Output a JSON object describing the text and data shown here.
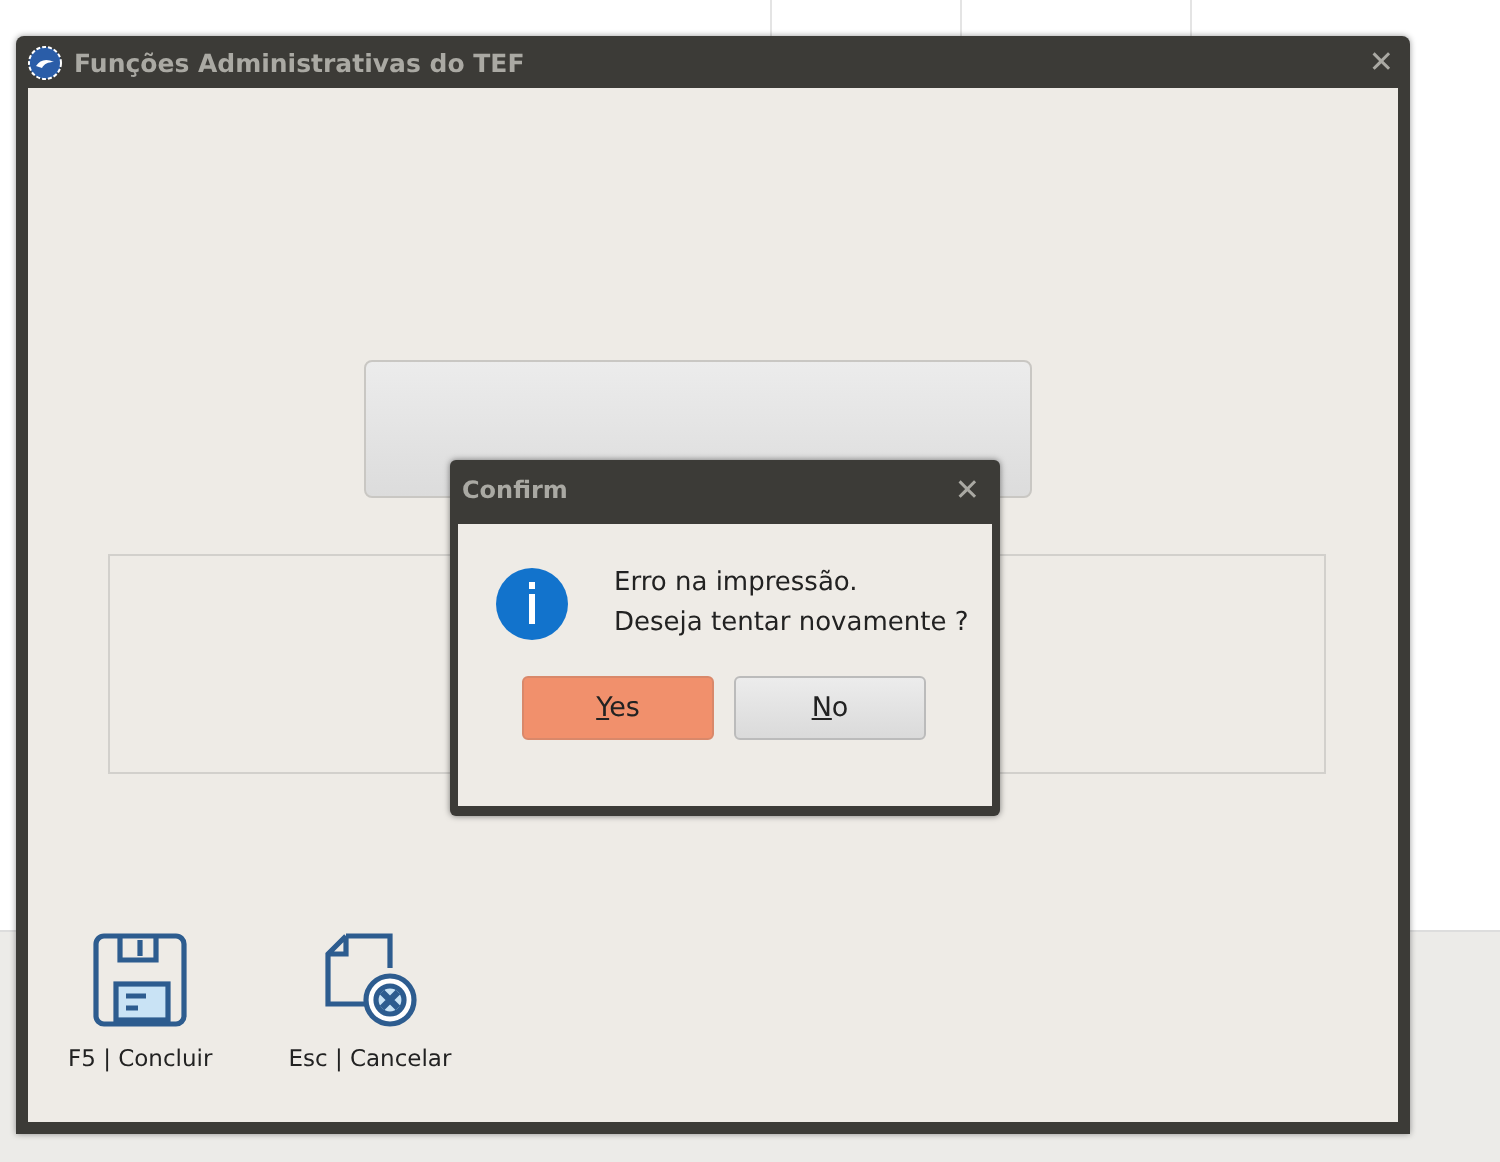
{
  "window": {
    "title": "Funções Administrativas do TEF",
    "close": "✕"
  },
  "dialog": {
    "title": "Confirm",
    "close": "✕",
    "message_lines": [
      "Erro na impressão.",
      "Deseja tentar novamente ?"
    ],
    "buttons": [
      {
        "label": "Yes",
        "mnemonic_underlined": true,
        "selected": true
      },
      {
        "label": "No",
        "mnemonic_underlined": true,
        "selected": false
      }
    ]
  },
  "toolbar": [
    {
      "kind": "save",
      "label": "F5 | Concluir"
    },
    {
      "kind": "cancel",
      "label": "Esc | Cancelar"
    }
  ]
}
